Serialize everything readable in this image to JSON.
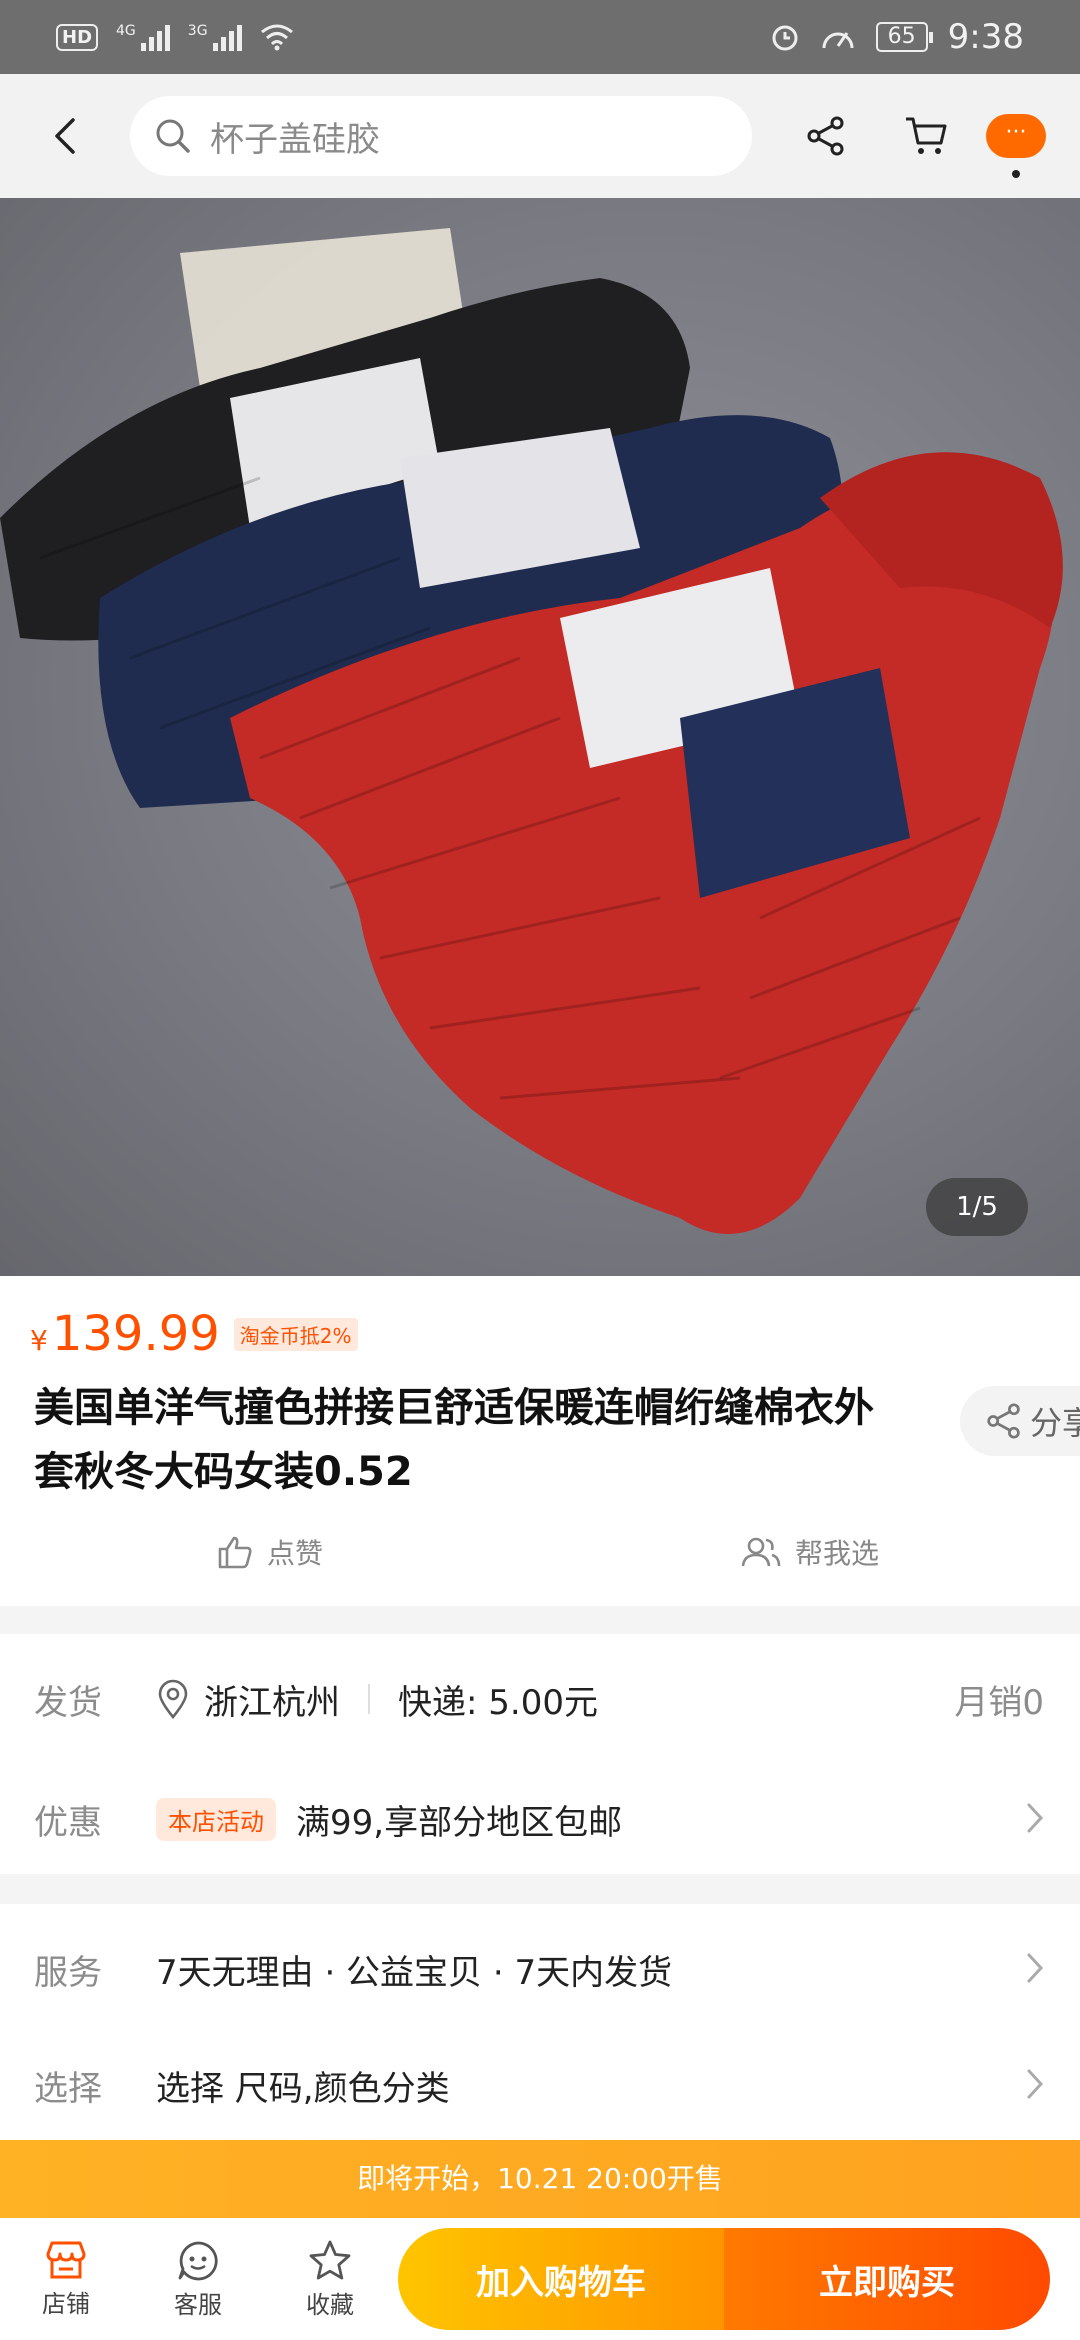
{
  "status_bar": {
    "network_label": "HD",
    "sim1": "4G",
    "sim2": "3G",
    "battery": "65",
    "time": "9:38"
  },
  "top_nav": {
    "search_placeholder": "杯子盖硅胶",
    "more_label": "···"
  },
  "gallery": {
    "counter": "1/5"
  },
  "product": {
    "currency": "¥",
    "price": "139.99",
    "coin_tag": "淘金币抵2%",
    "title": "美国单洋气撞色拼接巨舒适保暖连帽绗缝棉衣外套秋冬大码女装0.52",
    "share_label": "分享",
    "like_label": "点赞",
    "help_choose_label": "帮我选"
  },
  "shipping": {
    "label": "发货",
    "location": "浙江杭州",
    "express": "快递: 5.00元",
    "monthly_sales": "月销0"
  },
  "promo": {
    "label": "优惠",
    "tag": "本店活动",
    "text": "满99,享部分地区包邮"
  },
  "service": {
    "label": "服务",
    "text": "7天无理由 · 公益宝贝 · 7天内发货"
  },
  "select": {
    "label": "选择",
    "text": "选择 尺码,颜色分类"
  },
  "presale_banner": "即将开始，10.21 20:00开售",
  "bottom_bar": {
    "store": "店铺",
    "service": "客服",
    "favorite": "收藏",
    "add_to_cart": "加入购物车",
    "buy_now": "立即购买"
  },
  "colors": {
    "accent": "#ff5000",
    "cart_button": "#ffa400",
    "buy_button": "#ff5a00",
    "banner": "#ffae22"
  }
}
